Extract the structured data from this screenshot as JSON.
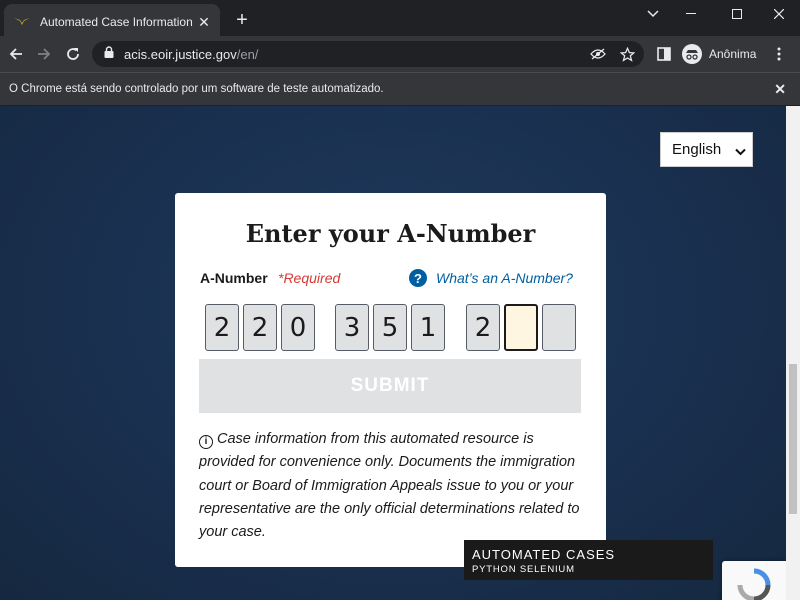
{
  "browser": {
    "tab_title": "Automated Case Information",
    "url_domain": "acis.eoir.justice.gov",
    "url_path": "/en/",
    "profile_label": "Anônima",
    "infobar_text": "O Chrome está sendo controlado por um software de teste automatizado."
  },
  "page": {
    "language": "English",
    "title": "Enter your A-Number",
    "anumber_label": "A-Number",
    "required_label": "*Required",
    "help_link": "What’s an A-Number?",
    "digits": [
      "2",
      "2",
      "0",
      "3",
      "5",
      "1",
      "2",
      "",
      ""
    ],
    "active_digit_index": 7,
    "submit_label": "SUBMIT",
    "disclaimer": "Case information from this automated resource is provided for convenience only. Documents the immigration court or Board of Immigration Appeals issue to you or your representative are the only official determinations related to your case."
  },
  "overlay": {
    "title": "AUTOMATED CASES",
    "subtitle": "PYTHON  SELENIUM"
  },
  "colors": {
    "link_blue": "#005ea2",
    "required_red": "#d83933",
    "page_bg": "#1a3152"
  }
}
